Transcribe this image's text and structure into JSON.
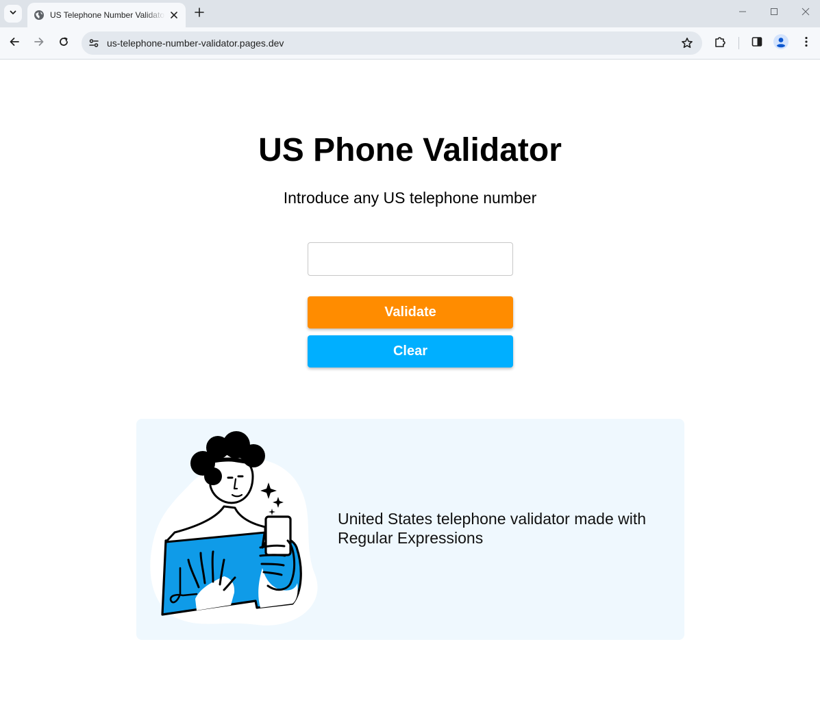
{
  "browser": {
    "tab_title": "US Telephone Number Validator",
    "url": "us-telephone-number-validator.pages.dev"
  },
  "main": {
    "title": "US Phone Validator",
    "subtitle": "Introduce any US telephone number",
    "input": {
      "value": "",
      "placeholder": ""
    },
    "validate_label": "Validate",
    "clear_label": "Clear",
    "colors": {
      "validate": "#ff8c00",
      "clear": "#00afff",
      "card_bg": "#eff8fe",
      "illustration_accent": "#0f9be8"
    }
  },
  "card": {
    "text": "United States telephone validator made with Regular Expressions",
    "illustration": "person-taking-selfie-with-phone"
  }
}
